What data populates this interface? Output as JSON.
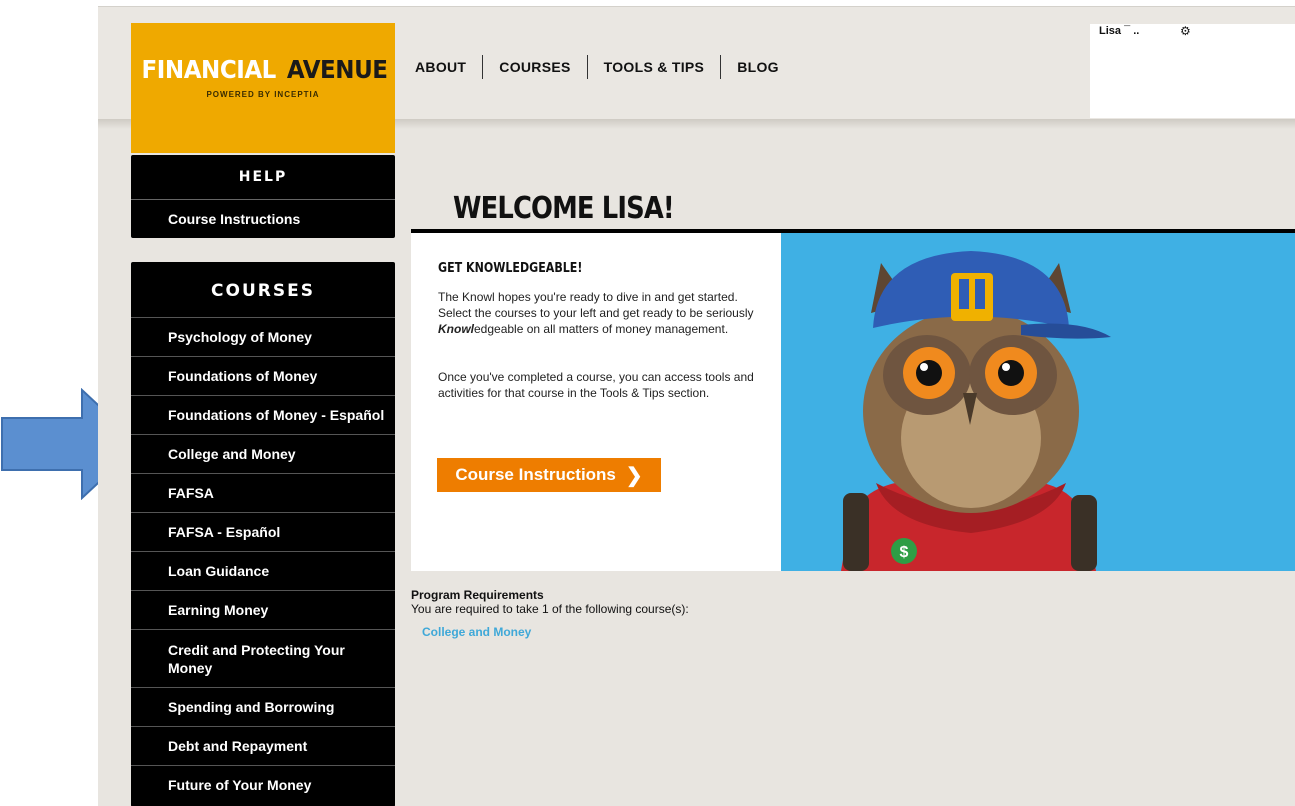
{
  "header": {
    "logo_word1": "FINANCIAL",
    "logo_word2": "AVENUE",
    "logo_sub": "POWERED BY INCEPTIA",
    "nav": [
      "ABOUT",
      "COURSES",
      "TOOLS & TIPS",
      "BLOG"
    ],
    "user_name": "Lisa ¯      ..",
    "gear_icon": "gear-icon"
  },
  "help_panel": {
    "title": "HELP",
    "items": [
      "Course Instructions"
    ]
  },
  "courses_panel": {
    "title": "COURSES",
    "items": [
      "Psychology of Money",
      "Foundations of Money",
      "Foundations of Money - Español",
      "College and Money",
      "FAFSA",
      "FAFSA - Español",
      "Loan Guidance",
      "Earning Money",
      "Credit and Protecting Your Money",
      "Spending and Borrowing",
      "Debt and Repayment",
      "Future of Your Money"
    ]
  },
  "main": {
    "welcome": "WELCOME LISA!",
    "card_heading": "GET KNOWLEDGEABLE!",
    "para1_a": "The Knowl hopes you're ready to dive in and get started. Select the courses to your left and get ready to be seriously ",
    "para1_em": "Knowl",
    "para1_b": "edgeable on all matters of money management.",
    "para2": "Once you've completed a course, you can access tools and activities for that course in the Tools & Tips section.",
    "cta_label": "Course Instructions",
    "cta_icon": "chevron-right-icon"
  },
  "requirements": {
    "title": "Program Requirements",
    "text": "You are required to take 1 of the following course(s):",
    "link": "College and Money"
  },
  "colors": {
    "logo_bg": "#efa900",
    "page_bg": "#e8e5e0",
    "cta_bg": "#ee7d00",
    "hero_bg": "#3fb0e4",
    "link": "#3fa8d8",
    "arrow_fill": "#5b8fd0"
  }
}
